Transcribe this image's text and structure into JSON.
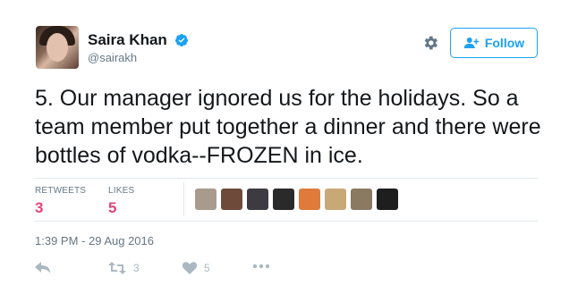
{
  "user": {
    "display_name": "Saira Khan",
    "handle": "@sairakh"
  },
  "follow_button": {
    "label": "Follow"
  },
  "tweet": {
    "text": "5. Our manager ignored us for the holidays. So a team member put together a dinner and there were bottles of vodka--FROZEN in ice.",
    "timestamp": "1:39 PM - 29 Aug 2016"
  },
  "stats": {
    "retweets_label": "RETWEETS",
    "retweets_value": "3",
    "likes_label": "LIKES",
    "likes_value": "5"
  },
  "actions": {
    "retweet_count": "3",
    "like_count": "5"
  },
  "liker_avatars": [
    {
      "name": "liker-avatar-1",
      "color": "#a89a8c"
    },
    {
      "name": "liker-avatar-2",
      "color": "#6e4a3a"
    },
    {
      "name": "liker-avatar-3",
      "color": "#3e3a42"
    },
    {
      "name": "liker-avatar-4",
      "color": "#2a2a2a"
    },
    {
      "name": "liker-avatar-5",
      "color": "#e07a3a"
    },
    {
      "name": "liker-avatar-6",
      "color": "#c9a878"
    },
    {
      "name": "liker-avatar-7",
      "color": "#8a7a62"
    },
    {
      "name": "liker-avatar-8",
      "color": "#1e1e1e"
    }
  ],
  "colors": {
    "accent": "#1da1f2",
    "stat_value": "#e0245e",
    "muted": "#657786",
    "icon": "#aab8c2"
  }
}
